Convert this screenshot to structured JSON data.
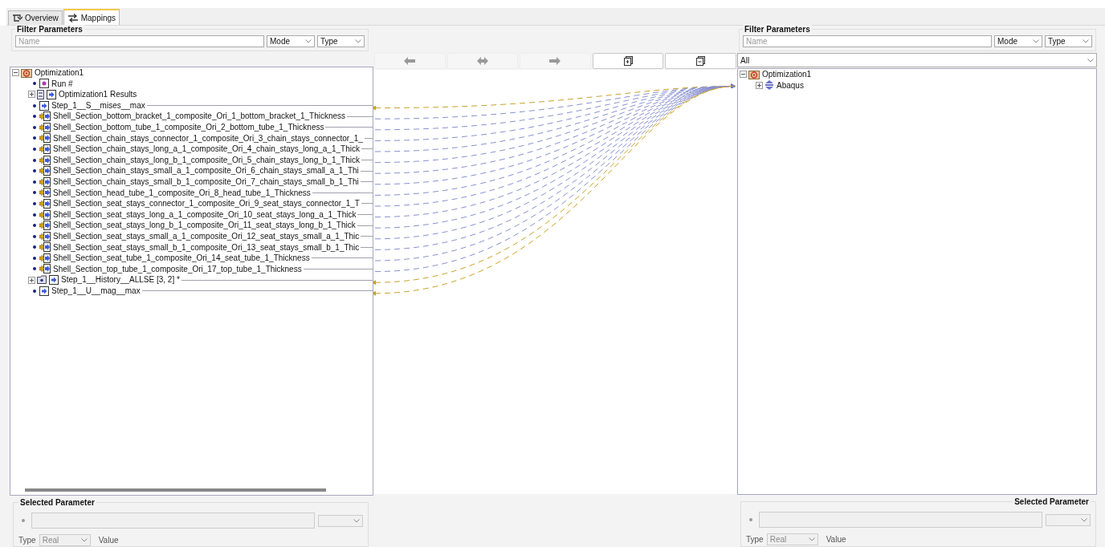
{
  "tabs": [
    {
      "label": "Overview",
      "kind": "overview",
      "selected": false
    },
    {
      "label": "Mappings",
      "kind": "mappings",
      "selected": true
    }
  ],
  "left": {
    "filter": {
      "title": "Filter Parameters",
      "placeholder": "Name",
      "mode": "Mode",
      "type": "Type"
    },
    "tree": {
      "label": "Optimization1",
      "kind": "root",
      "expanded": true,
      "children": [
        {
          "label": "Run #",
          "kind": "run"
        },
        {
          "label": "Optimization1 Results",
          "kind": "group",
          "expanded": false
        },
        {
          "label": "Step_1__S__mises__max",
          "kind": "output"
        },
        {
          "label": "Shell_Section_bottom_bracket_1_composite_Ori_1_bottom_bracket_1_Thickness",
          "kind": "input"
        },
        {
          "label": "Shell_Section_bottom_tube_1_composite_Ori_2_bottom_tube_1_Thickness",
          "kind": "input"
        },
        {
          "label": "Shell_Section_chain_stays_connector_1_composite_Ori_3_chain_stays_connector_1_",
          "kind": "input"
        },
        {
          "label": "Shell_Section_chain_stays_long_a_1_composite_Ori_4_chain_stays_long_a_1_Thick",
          "kind": "input"
        },
        {
          "label": "Shell_Section_chain_stays_long_b_1_composite_Ori_5_chain_stays_long_b_1_Thick",
          "kind": "input"
        },
        {
          "label": "Shell_Section_chain_stays_small_a_1_composite_Ori_6_chain_stays_small_a_1_Thi",
          "kind": "input"
        },
        {
          "label": "Shell_Section_chain_stays_small_b_1_composite_Ori_7_chain_stays_small_b_1_Thi",
          "kind": "input"
        },
        {
          "label": "Shell_Section_head_tube_1_composite_Ori_8_head_tube_1_Thickness",
          "kind": "input"
        },
        {
          "label": "Shell_Section_seat_stays_connector_1_composite_Ori_9_seat_stays_connector_1_T",
          "kind": "input"
        },
        {
          "label": "Shell_Section_seat_stays_long_a_1_composite_Ori_10_seat_stays_long_a_1_Thick",
          "kind": "input"
        },
        {
          "label": "Shell_Section_seat_stays_long_b_1_composite_Ori_11_seat_stays_long_b_1_Thick",
          "kind": "input"
        },
        {
          "label": "Shell_Section_seat_stays_small_a_1_composite_Ori_12_seat_stays_small_a_1_Thic",
          "kind": "input"
        },
        {
          "label": "Shell_Section_seat_stays_small_b_1_composite_Ori_13_seat_stays_small_b_1_Thic",
          "kind": "input"
        },
        {
          "label": "Shell_Section_seat_tube_1_composite_Ori_14_seat_tube_1_Thickness",
          "kind": "input"
        },
        {
          "label": "Shell_Section_top_tube_1_composite_Ori_17_top_tube_1_Thickness",
          "kind": "input"
        },
        {
          "label": "Step_1__History__ALLSE [3, 2] *",
          "kind": "history",
          "expanded": false
        },
        {
          "label": "Step_1__U__mag__max",
          "kind": "output"
        }
      ]
    },
    "selected": {
      "title": "Selected Parameter",
      "type_label": "Type",
      "type_value": "Real",
      "value_label": "Value"
    }
  },
  "buttons": [
    {
      "kind": "map-left",
      "disabled": true
    },
    {
      "kind": "map-both",
      "disabled": true
    },
    {
      "kind": "map-right",
      "disabled": true
    },
    {
      "kind": "expand-all",
      "disabled": false
    },
    {
      "kind": "collapse-all",
      "disabled": false
    }
  ],
  "right": {
    "filter": {
      "title": "Filter Parameters",
      "placeholder": "Name",
      "mode": "Mode",
      "type": "Type"
    },
    "scope": "All",
    "tree": {
      "label": "Optimization1",
      "kind": "root",
      "expanded": true,
      "children": [
        {
          "label": "Abaqus",
          "kind": "component",
          "expanded": false
        }
      ]
    },
    "selected": {
      "title": "Selected Parameter",
      "type_label": "Type",
      "type_value": "Real",
      "value_label": "Value"
    }
  }
}
